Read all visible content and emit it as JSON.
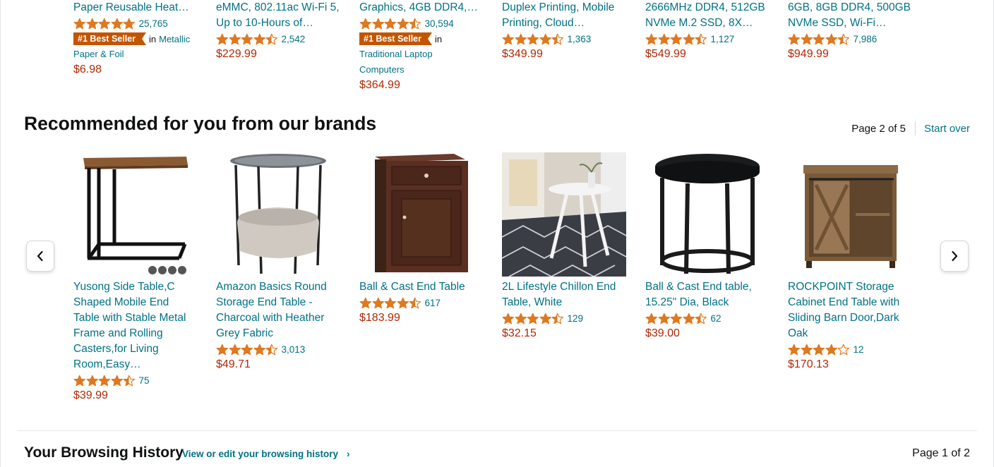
{
  "top_products": [
    {
      "title_line": "Paper Reusable Heat…",
      "rating": 4.8,
      "reviews": "25,765",
      "badge": "#1 Best Seller",
      "badge_in": "in",
      "badge_cat_1": "Metallic",
      "badge_cat_2": "Paper & Foil",
      "price": "$6.98"
    },
    {
      "title_1": "eMMC, 802.11ac Wi-Fi 5,",
      "title_2": "Up to 10-Hours of…",
      "rating": 4.5,
      "reviews": "2,542",
      "price": "$229.99"
    },
    {
      "title_line": "Graphics, 4GB DDR4,…",
      "rating": 4.5,
      "reviews": "30,594",
      "badge": "#1 Best Seller",
      "badge_in": "in",
      "badge_cat_1": "Traditional Laptop",
      "badge_cat_2": "Computers",
      "price": "$364.99"
    },
    {
      "title_1": "Duplex Printing, Mobile",
      "title_2": "Printing, Cloud…",
      "rating": 4.5,
      "reviews": "1,363",
      "price": "$349.99"
    },
    {
      "title_1": "2666MHz DDR4, 512GB",
      "title_2": "NVMe M.2 SSD, 8X…",
      "rating": 4.5,
      "reviews": "1,127",
      "price": "$549.99"
    },
    {
      "title_1": "6GB, 8GB DDR4, 500GB",
      "title_2": "NVMe SSD, Wi-Fi…",
      "rating": 4.5,
      "reviews": "7,986",
      "price": "$949.99"
    }
  ],
  "section": {
    "title": "Recommended for you from our brands",
    "page": "Page 2 of 5",
    "start_over": "Start over"
  },
  "recommended": [
    {
      "lines": [
        "Yusong Side Table,C",
        "Shaped Mobile End",
        "Table with Stable Metal",
        "Frame and Rolling",
        "Casters,for Living",
        "Room,Easy…"
      ],
      "rating": 4.5,
      "reviews": "75",
      "price": "$39.99"
    },
    {
      "lines": [
        "Amazon Basics Round",
        "Storage End Table -",
        "Charcoal with Heather",
        "Grey Fabric"
      ],
      "rating": 4.5,
      "reviews": "3,013",
      "price": "$49.71"
    },
    {
      "lines": [
        "Ball & Cast End Table"
      ],
      "rating": 4.5,
      "reviews": "617",
      "price": "$183.99"
    },
    {
      "lines": [
        "2L Lifestyle Chillon End",
        "Table, White"
      ],
      "rating": 4.5,
      "reviews": "129",
      "price": "$32.15"
    },
    {
      "lines": [
        "Ball & Cast End table,",
        "15.25\" Dia, Black"
      ],
      "rating": 4.5,
      "reviews": "62",
      "price": "$39.00"
    },
    {
      "lines": [
        "ROCKPOINT Storage",
        "Cabinet End Table with",
        "Sliding Barn Door,Dark",
        "Oak"
      ],
      "rating": 4.0,
      "reviews": "12",
      "price": "$170.13"
    }
  ],
  "browsing_history": {
    "title": "Your Browsing History",
    "link": "View or edit your browsing history",
    "link_chevron": "›",
    "page": "Page 1 of 2"
  },
  "colors": {
    "link": "#007185",
    "price": "#b12704",
    "star": "#de7921",
    "badge": "#c45500"
  }
}
